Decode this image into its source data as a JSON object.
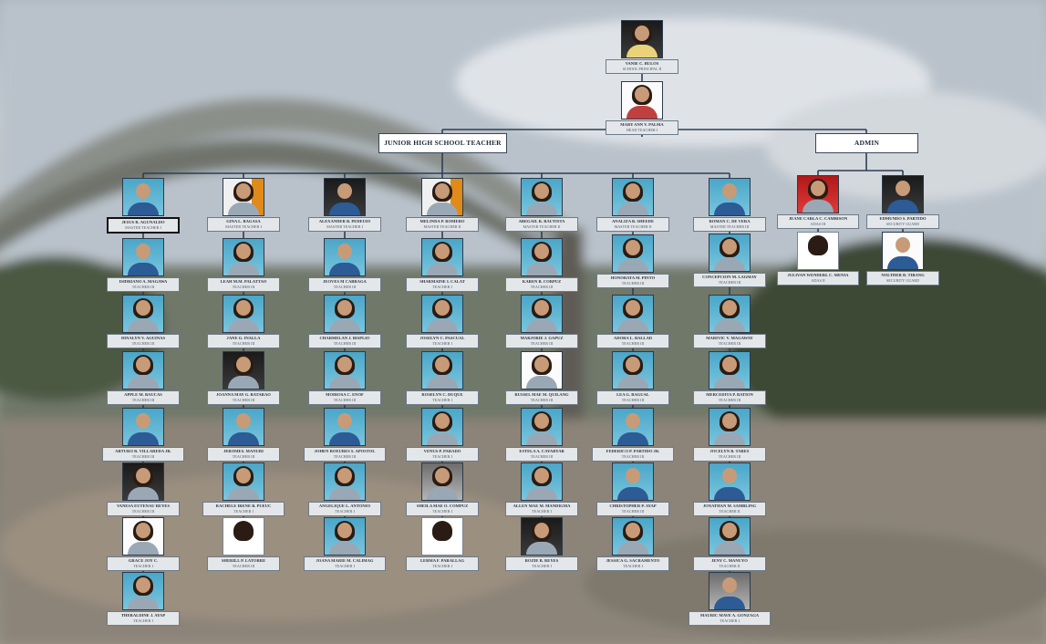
{
  "principal": {
    "name": "VANIE C. BULOS",
    "position": "SCHOOL PRINCIPAL II"
  },
  "head_teacher": {
    "name": "MARY ANN V. PALMA",
    "position": "HEAD TEACHER I"
  },
  "headers": {
    "jhs": "JUNIOR HIGH SCHOOL  TEACHER",
    "admin": "ADMIN"
  },
  "col1": [
    {
      "name": "JESUS R. AGUNALDO",
      "position": "MASTER TEACHER I"
    },
    {
      "name": "ISIDRIANO A. MAGAWA",
      "position": "TEACHER III"
    },
    {
      "name": "DINALYN V. AGUINAS",
      "position": "TEACHER III"
    },
    {
      "name": "APPLE M. BAUCAS",
      "position": "TEACHER III"
    },
    {
      "name": "ARTURO R. VILLAREDA JR.",
      "position": "TEACHER III"
    },
    {
      "name": "VANESA EUTENAU REYES",
      "position": "TEACHER III"
    },
    {
      "name": "GRACE JOY C.",
      "position": "TEACHER I"
    },
    {
      "name": "THERALDINE J. AYAP",
      "position": "TEACHER I"
    }
  ],
  "col2": [
    {
      "name": "GINA L. BAGASA",
      "position": "MASTER TEACHER I"
    },
    {
      "name": "LEAH M.M. PALATTAO",
      "position": "TEACHER III"
    },
    {
      "name": "JANE G. INALLA",
      "position": "TEACHER III"
    },
    {
      "name": "JOANNA MAY G. BATARAO",
      "position": "TEACHER III"
    },
    {
      "name": "JEROMES. MANURI",
      "position": "TEACHER III"
    },
    {
      "name": "RACHELE IRENE B. PUEUC",
      "position": "TEACHER I"
    },
    {
      "name": "SHERILL P. LATORRE",
      "position": "TEACHER III"
    }
  ],
  "col3": [
    {
      "name": "ALEXANDER B. PEDEUIO",
      "position": "MASTER TEACHER I"
    },
    {
      "name": "JEOVES M CABRAGA",
      "position": "TEACHER III"
    },
    {
      "name": "CHARMELAN J. BISPLIO",
      "position": "TEACHER III"
    },
    {
      "name": "MOIROSA C. ENOF",
      "position": "TEACHER III"
    },
    {
      "name": "JOHEN ROEURES S. APOSTOL",
      "position": "TEACHER III"
    },
    {
      "name": "ANGELIQUE L. ANTONIO",
      "position": "TEACHER I"
    },
    {
      "name": "JOANA MARIE M. CALIMAG",
      "position": "TEACHER I"
    }
  ],
  "col4": [
    {
      "name": "MELINDA P. ROMERO",
      "position": "MASTER TEACHER II"
    },
    {
      "name": "SHARMAINE I. CALAT",
      "position": "TEACHER I"
    },
    {
      "name": "JOSELYN C. PASCUAL",
      "position": "TEACHER I"
    },
    {
      "name": "ROSELYN C. DUQUE",
      "position": "TEACHER I"
    },
    {
      "name": "VENUS P. PARADO",
      "position": "TEACHER I"
    },
    {
      "name": "SHEILA MAE O. COMPUZ",
      "position": "TEACHER I"
    },
    {
      "name": "LERMA F. PARALLAG",
      "position": "TEACHER I"
    }
  ],
  "col5": [
    {
      "name": "ABEGAIL R. BAUTISTA",
      "position": "MASTER TEACHER II"
    },
    {
      "name": "KAREN B. CORPUZ",
      "position": "TEACHER III"
    },
    {
      "name": "MARJORIE J. GAPUZ",
      "position": "TEACHER III"
    },
    {
      "name": "RUSSEL MAE M. QUILANG",
      "position": "TEACHER III"
    },
    {
      "name": "ESTELA A. CAYABYAB",
      "position": "TEACHER III"
    },
    {
      "name": "ALLEN MAE M. MANDIGMA",
      "position": "TEACHER I"
    },
    {
      "name": "ROZIE B. REYES",
      "position": "TEACHER I"
    }
  ],
  "col6": [
    {
      "name": "ANALIZA B. SHEEDE",
      "position": "MASTER TEACHER II"
    },
    {
      "name": "HONORATA M. PINTO",
      "position": "TEACHER III"
    },
    {
      "name": "ADORA L. BALLAD",
      "position": "TEACHER III"
    },
    {
      "name": "LEA G. BAGUAL",
      "position": "TEACHER III"
    },
    {
      "name": "FEDERICO P. PARTIDO JR.",
      "position": "TEACHER III"
    },
    {
      "name": "CHRISTOPHER P. AYAP",
      "position": "TEACHER III"
    },
    {
      "name": "JESSICA G. SACRAMENTO",
      "position": "TEACHER I"
    }
  ],
  "col7": [
    {
      "name": "ROMAN C. DE VERA",
      "position": "MASTER TEACHER III"
    },
    {
      "name": "CONCEPCION M. LAGMAY",
      "position": "TEACHER III"
    },
    {
      "name": "MARIVIC V. MAGAWAY",
      "position": "TEACHER III"
    },
    {
      "name": "MERCEDITA P. BATION",
      "position": "TEACHER III"
    },
    {
      "name": "JOCELYN B. TARES",
      "position": "TEACHER III"
    },
    {
      "name": "JONATHAN M. SAMBLING",
      "position": "TEACHER II"
    },
    {
      "name": "JENY C. MANUYO",
      "position": "TEACHER II"
    },
    {
      "name": "MAURIC MAVE A. GONZAGA",
      "position": "TEACHER I"
    }
  ],
  "admin1": [
    {
      "name": "JEANE CARLA C. CAMBISON",
      "position": "ADAS III"
    },
    {
      "name": "JULIVAN WENDERL C. MENIA",
      "position": "ADAS II"
    }
  ],
  "admin2": [
    {
      "name": "EDMUNDO S. PARTIDO",
      "position": "SECURITY GUARD"
    },
    {
      "name": "NOLTHER R. TIBANG",
      "position": "SECURITY GUARD"
    }
  ]
}
